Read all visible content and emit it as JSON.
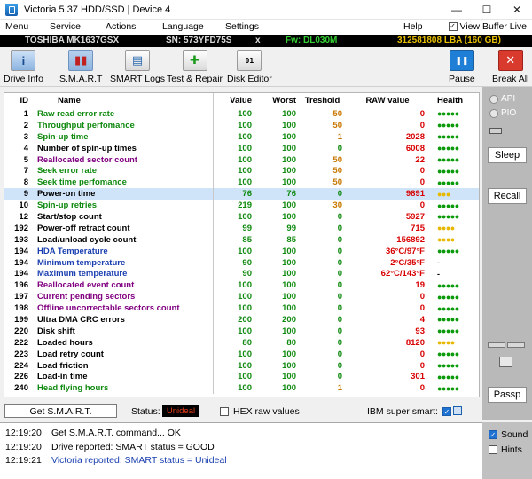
{
  "window": {
    "title": "Victoria 5.37 HDD/SSD | Device 4",
    "minimize": "—",
    "maximize": "☐",
    "close": "✕"
  },
  "menu": {
    "items": [
      "Menu",
      "Service",
      "Actions",
      "Language",
      "Settings",
      "Help"
    ],
    "view_buffer_label": "View Buffer Live",
    "view_buffer_checked": "✓"
  },
  "drive": {
    "model": "TOSHIBA MK1637GSX",
    "serial": "SN: 573YFD75S",
    "close_x": "x",
    "firmware": "Fw: DL030M",
    "lba": "312581808 LBA (160 GB)"
  },
  "toolbar": {
    "buttons": [
      {
        "label": "Drive Info",
        "icon": "info-icon",
        "glyph": "i"
      },
      {
        "label": "S.M.A.R.T",
        "icon": "smart-chart-icon",
        "glyph": "▮▮"
      },
      {
        "label": "SMART Logs",
        "icon": "logs-icon",
        "glyph": "▤"
      },
      {
        "label": "Test & Repair",
        "icon": "medkit-icon",
        "glyph": "✚"
      },
      {
        "label": "Disk Editor",
        "icon": "binary-icon",
        "glyph": "01"
      },
      {
        "label": "Pause",
        "icon": "pause-icon",
        "glyph": "❚❚"
      },
      {
        "label": "Break All",
        "icon": "stop-icon",
        "glyph": "✕"
      }
    ]
  },
  "table": {
    "headers": [
      "ID",
      "Name",
      "Value",
      "Worst",
      "Treshold",
      "RAW value",
      "Health"
    ],
    "rows": [
      {
        "id": "1",
        "name": "Raw read error rate",
        "value": "100",
        "worst": "100",
        "threshold": "50",
        "raw": "0",
        "health": "●●●●●",
        "name_color": "green",
        "thr_color": "orange",
        "raw_color": "red",
        "health_color": "green"
      },
      {
        "id": "2",
        "name": "Throughput perfomance",
        "value": "100",
        "worst": "100",
        "threshold": "50",
        "raw": "0",
        "health": "●●●●●",
        "name_color": "green",
        "thr_color": "orange",
        "raw_color": "red",
        "health_color": "green"
      },
      {
        "id": "3",
        "name": "Spin-up time",
        "value": "100",
        "worst": "100",
        "threshold": "1",
        "raw": "2028",
        "health": "●●●●●",
        "name_color": "green",
        "thr_color": "orange",
        "raw_color": "red",
        "health_color": "green"
      },
      {
        "id": "4",
        "name": "Number of spin-up times",
        "value": "100",
        "worst": "100",
        "threshold": "0",
        "raw": "6008",
        "health": "●●●●●",
        "name_color": "black",
        "thr_color": "green",
        "raw_color": "red",
        "health_color": "green"
      },
      {
        "id": "5",
        "name": "Reallocated sector count",
        "value": "100",
        "worst": "100",
        "threshold": "50",
        "raw": "22",
        "health": "●●●●●",
        "name_color": "purple",
        "thr_color": "orange",
        "raw_color": "red",
        "health_color": "green"
      },
      {
        "id": "7",
        "name": "Seek error rate",
        "value": "100",
        "worst": "100",
        "threshold": "50",
        "raw": "0",
        "health": "●●●●●",
        "name_color": "green",
        "thr_color": "orange",
        "raw_color": "red",
        "health_color": "green"
      },
      {
        "id": "8",
        "name": "Seek time perfomance",
        "value": "100",
        "worst": "100",
        "threshold": "50",
        "raw": "0",
        "health": "●●●●●",
        "name_color": "green",
        "thr_color": "orange",
        "raw_color": "red",
        "health_color": "green"
      },
      {
        "id": "9",
        "name": "Power-on time",
        "value": "76",
        "worst": "76",
        "threshold": "0",
        "raw": "9891",
        "health": "●●●",
        "name_color": "black",
        "thr_color": "green",
        "raw_color": "red",
        "health_color": "yellow",
        "selected": true
      },
      {
        "id": "10",
        "name": "Spin-up retries",
        "value": "219",
        "worst": "100",
        "threshold": "30",
        "raw": "0",
        "health": "●●●●●",
        "name_color": "green",
        "thr_color": "orange",
        "raw_color": "red",
        "health_color": "green"
      },
      {
        "id": "12",
        "name": "Start/stop count",
        "value": "100",
        "worst": "100",
        "threshold": "0",
        "raw": "5927",
        "health": "●●●●●",
        "name_color": "black",
        "thr_color": "green",
        "raw_color": "red",
        "health_color": "green"
      },
      {
        "id": "192",
        "name": "Power-off retract count",
        "value": "99",
        "worst": "99",
        "threshold": "0",
        "raw": "715",
        "health": "●●●●",
        "name_color": "black",
        "thr_color": "green",
        "raw_color": "red",
        "health_color": "yellow"
      },
      {
        "id": "193",
        "name": "Load/unload cycle count",
        "value": "85",
        "worst": "85",
        "threshold": "0",
        "raw": "156892",
        "health": "●●●●",
        "name_color": "black",
        "thr_color": "green",
        "raw_color": "red",
        "health_color": "yellow"
      },
      {
        "id": "194",
        "name": "HDA Temperature",
        "value": "100",
        "worst": "100",
        "threshold": "0",
        "raw": "36°C/97°F",
        "health": "●●●●●",
        "name_color": "blue",
        "thr_color": "green",
        "raw_color": "red",
        "health_color": "green"
      },
      {
        "id": "194",
        "name": "Minimum temperature",
        "value": "90",
        "worst": "100",
        "threshold": "0",
        "raw": "2°C/35°F",
        "health": "-",
        "name_color": "blue",
        "thr_color": "green",
        "raw_color": "red",
        "health_color": "black"
      },
      {
        "id": "194",
        "name": "Maximum temperature",
        "value": "90",
        "worst": "100",
        "threshold": "0",
        "raw": "62°C/143°F",
        "health": "-",
        "name_color": "blue",
        "thr_color": "green",
        "raw_color": "red",
        "health_color": "black"
      },
      {
        "id": "196",
        "name": "Reallocated event count",
        "value": "100",
        "worst": "100",
        "threshold": "0",
        "raw": "19",
        "health": "●●●●●",
        "name_color": "purple",
        "thr_color": "green",
        "raw_color": "red",
        "health_color": "green"
      },
      {
        "id": "197",
        "name": "Current pending sectors",
        "value": "100",
        "worst": "100",
        "threshold": "0",
        "raw": "0",
        "health": "●●●●●",
        "name_color": "purple",
        "thr_color": "green",
        "raw_color": "red",
        "health_color": "green"
      },
      {
        "id": "198",
        "name": "Offline uncorrectable sectors count",
        "value": "100",
        "worst": "100",
        "threshold": "0",
        "raw": "0",
        "health": "●●●●●",
        "name_color": "purple",
        "thr_color": "green",
        "raw_color": "red",
        "health_color": "green"
      },
      {
        "id": "199",
        "name": "Ultra DMA CRC errors",
        "value": "200",
        "worst": "200",
        "threshold": "0",
        "raw": "4",
        "health": "●●●●●",
        "name_color": "black",
        "thr_color": "green",
        "raw_color": "red",
        "health_color": "green"
      },
      {
        "id": "220",
        "name": "Disk shift",
        "value": "100",
        "worst": "100",
        "threshold": "0",
        "raw": "93",
        "health": "●●●●●",
        "name_color": "black",
        "thr_color": "green",
        "raw_color": "red",
        "health_color": "green"
      },
      {
        "id": "222",
        "name": "Loaded hours",
        "value": "80",
        "worst": "80",
        "threshold": "0",
        "raw": "8120",
        "health": "●●●●",
        "name_color": "black",
        "thr_color": "green",
        "raw_color": "red",
        "health_color": "yellow"
      },
      {
        "id": "223",
        "name": "Load retry count",
        "value": "100",
        "worst": "100",
        "threshold": "0",
        "raw": "0",
        "health": "●●●●●",
        "name_color": "black",
        "thr_color": "green",
        "raw_color": "red",
        "health_color": "green"
      },
      {
        "id": "224",
        "name": "Load friction",
        "value": "100",
        "worst": "100",
        "threshold": "0",
        "raw": "0",
        "health": "●●●●●",
        "name_color": "black",
        "thr_color": "green",
        "raw_color": "red",
        "health_color": "green"
      },
      {
        "id": "226",
        "name": "Load-in time",
        "value": "100",
        "worst": "100",
        "threshold": "0",
        "raw": "301",
        "health": "●●●●●",
        "name_color": "black",
        "thr_color": "green",
        "raw_color": "red",
        "health_color": "green"
      },
      {
        "id": "240",
        "name": "Head flying hours",
        "value": "100",
        "worst": "100",
        "threshold": "1",
        "raw": "0",
        "health": "●●●●●",
        "name_color": "green",
        "thr_color": "orange",
        "raw_color": "red",
        "health_color": "green"
      }
    ]
  },
  "right_panel": {
    "api_label": "API",
    "pio_label": "PIO",
    "sleep_label": "Sleep",
    "recall_label": "Recall",
    "passp_label": "Passp"
  },
  "status": {
    "get_smart_label": "Get S.M.A.R.T.",
    "status_label": "Status:",
    "status_value": "Unideal",
    "hex_label": "HEX raw values",
    "ibm_label": "IBM super smart:",
    "ibm_checked": "✓"
  },
  "log": {
    "entries": [
      {
        "time": "12:19:20",
        "message": "Get S.M.A.R.T. command... OK",
        "color": "black"
      },
      {
        "time": "12:19:20",
        "message": "Drive reported: SMART status = GOOD",
        "color": "black"
      },
      {
        "time": "12:19:21",
        "message": "Victoria reported: SMART status = Unideal",
        "color": "blue"
      }
    ],
    "sound_label": "Sound",
    "sound_checked": "✓",
    "hints_label": "Hints"
  },
  "colors": {
    "green": "#108a10",
    "purple": "#800080",
    "blue": "#1a3fb0",
    "orange": "#c87800",
    "red": "#d80000",
    "health_yellow": "#e8b800",
    "selected_row": "#cfe4f8",
    "panel_gray": "#b9b9b9"
  }
}
